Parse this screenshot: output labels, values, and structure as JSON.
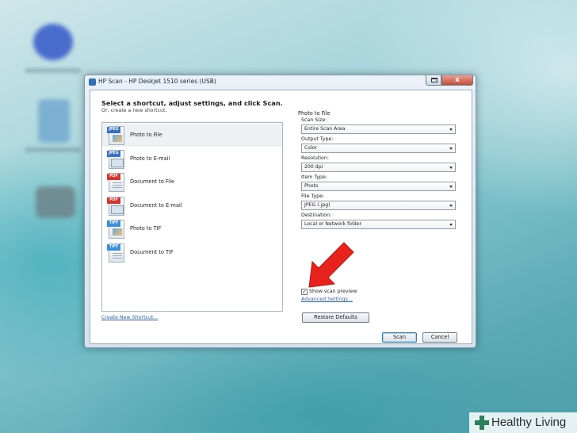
{
  "window": {
    "title": "HP Scan - HP Deskjet 1510 series (USB)",
    "close_glyph": "x"
  },
  "main": {
    "heading": "Select a shortcut, adjust settings, and click Scan.",
    "subheading": "Or, create a new shortcut.",
    "shortcuts": [
      {
        "label": "Photo to File",
        "tag": "JPEG",
        "tag_color": "#3b6fc0",
        "icon": "jpeg-photo-icon",
        "selected": true
      },
      {
        "label": "Photo to E-mail",
        "tag": "JPEG",
        "tag_color": "#3b6fc0",
        "icon": "jpeg-email-icon",
        "selected": false
      },
      {
        "label": "Document to File",
        "tag": "PDF",
        "tag_color": "#d9342b",
        "icon": "pdf-document-icon",
        "selected": false
      },
      {
        "label": "Document to E-mail",
        "tag": "PDF",
        "tag_color": "#d9342b",
        "icon": "pdf-email-icon",
        "selected": false
      },
      {
        "label": "Photo to TIF",
        "tag": "TIFF",
        "tag_color": "#3b8fd6",
        "icon": "tiff-photo-icon",
        "selected": false
      },
      {
        "label": "Document to TIF",
        "tag": "TIFF",
        "tag_color": "#3b8fd6",
        "icon": "tiff-document-icon",
        "selected": false
      }
    ],
    "create_link": "Create New Shortcut..."
  },
  "settings": {
    "title": "Photo to File",
    "fields": [
      {
        "label": "Scan Size:",
        "value": "Entire Scan Area"
      },
      {
        "label": "Output Type:",
        "value": "Color"
      },
      {
        "label": "Resolution:",
        "value": "200 dpi"
      },
      {
        "label": "Item Type:",
        "value": "Photo"
      },
      {
        "label": "File Type:",
        "value": "JPEG (.jpg)"
      },
      {
        "label": "Destination:",
        "value": "Local or Network folder"
      }
    ],
    "show_preview_label": "Show scan preview",
    "show_preview_checked": true,
    "check_glyph": "✓",
    "advanced_link": "Advanced Settings...",
    "restore_label": "Restore Defaults"
  },
  "footer": {
    "scan_label": "Scan",
    "cancel_label": "Cancel"
  },
  "annotation": {
    "arrow_color": "#e8221c"
  },
  "watermark": {
    "text": "Healthy Living",
    "plus_color": "#2e7d5b"
  }
}
